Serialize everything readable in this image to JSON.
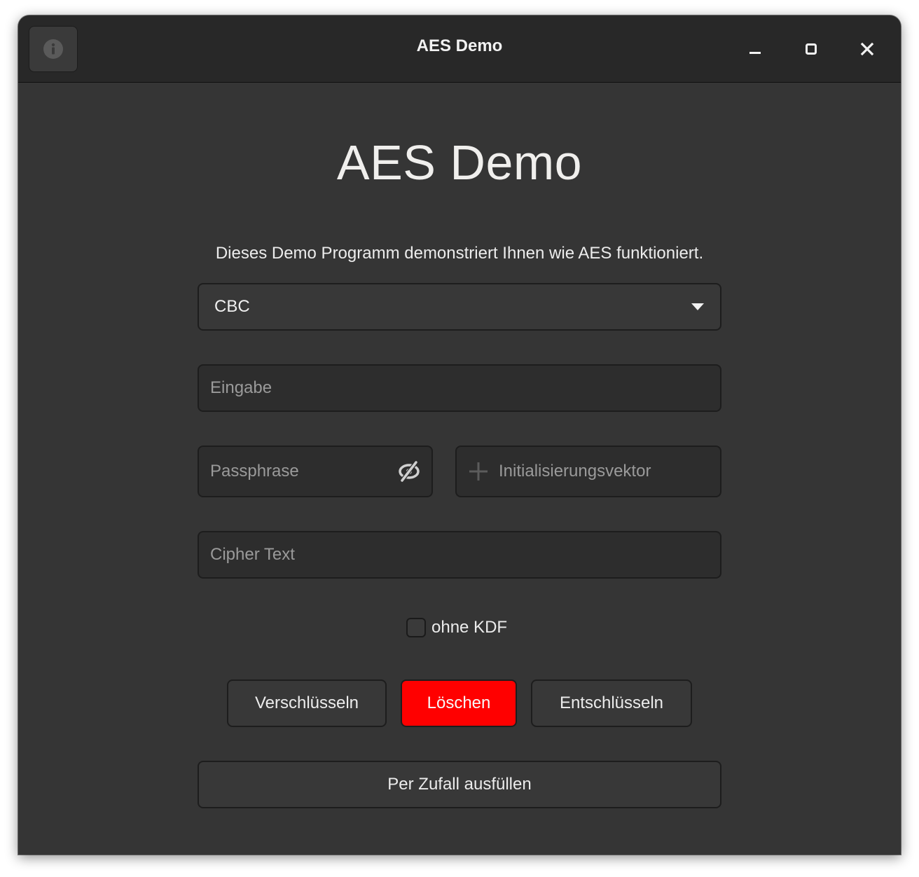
{
  "window": {
    "title": "AES Demo",
    "controls": {
      "info": "info-icon",
      "minimize": "minimize-icon",
      "maximize": "maximize-icon",
      "close": "close-icon"
    }
  },
  "main": {
    "heading": "AES Demo",
    "description": "Dieses Demo Programm demonstriert Ihnen wie AES funktioniert.",
    "mode_select": {
      "selected": "CBC"
    },
    "input": {
      "placeholder": "Eingabe",
      "value": ""
    },
    "passphrase": {
      "placeholder": "Passphrase",
      "value": "",
      "icon": "eye-slash-icon"
    },
    "iv": {
      "placeholder": "Initialisierungsvektor",
      "value": "",
      "icon": "plus-icon"
    },
    "cipher": {
      "placeholder": "Cipher Text",
      "value": ""
    },
    "kdf_checkbox": {
      "label": "ohne KDF",
      "checked": false
    },
    "buttons": {
      "encrypt": "Verschlüsseln",
      "delete": "Löschen",
      "decrypt": "Entschlüsseln",
      "random_fill": "Per Zufall ausfüllen"
    },
    "colors": {
      "delete_button": "#ff0000",
      "background": "#353535",
      "titlebar": "#282828"
    }
  }
}
